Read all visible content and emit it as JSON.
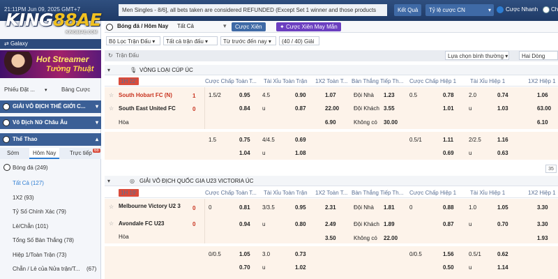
{
  "topbar": {
    "time": "21:11PM Jun 09, 2025 GMT+7",
    "notice": "Men Singles - 8/6], all bets taken are considered REFUNDED (Except Set 1 winner and those products",
    "result_button": "Kết Quả",
    "odds_select": "Tỷ lệ cược CN",
    "quick_bet_label": "Cược Nhanh",
    "quick_bet_on": true,
    "live_label": "Chế",
    "live_on": false
  },
  "logo": {
    "text_a": "KING",
    "text_b": "88AE",
    "sub": "KING88AE.COM"
  },
  "sidebar": {
    "galaxy_label": "Galaxy",
    "promo_line1": "Hot Streamer",
    "promo_line2": "Tường Thuật",
    "tab_betslip": "Phiếu Đặt ...",
    "tab_bets": "Bảng Cược",
    "sections": [
      {
        "label": "GIẢI VÔ ĐỊCH THẾ GIỚI C..."
      },
      {
        "label": "Vô Địch Nữ Châu Âu"
      },
      {
        "label": "Thể Thao"
      }
    ],
    "time_tabs": [
      "Sớm",
      "Hôm Nay",
      "Trực tiếp"
    ],
    "live_badge": "68",
    "items": [
      {
        "label": "Bóng đá",
        "count": "(249)"
      },
      {
        "label": "Tất Cả",
        "count": "(127)"
      },
      {
        "label": "1X2",
        "count": "(93)"
      },
      {
        "label": "Tỷ Số Chính Xác",
        "count": "(79)"
      },
      {
        "label": "Lẻ/Chẵn",
        "count": "(101)"
      },
      {
        "label": "Tổng Số Bàn Thắng",
        "count": "(78)"
      },
      {
        "label": "Hiệp 1/Toàn Trận",
        "count": "(73)"
      },
      {
        "label": "Chẵn / Lẻ của Nửa trận/T...",
        "count": "(67)"
      }
    ]
  },
  "breadcrumb": {
    "title": "Bóng đá / Hôm Nay",
    "filter": "Tất Cả",
    "btn_parlay": "Cược Xiên",
    "btn_lucky_parlay": "Cược Xiên May Mắn"
  },
  "filters": {
    "league_filter": "Bộ Lọc Trận Đấu",
    "all_matches": "Tất cả trận đấu",
    "sort": "Từ trước đến nay",
    "count": "(40 / 40) Giải",
    "normal_select": "Lựa chọn bình thường",
    "two_row": "Hai Dòng"
  },
  "section_label": "Trận Đấu",
  "page_badge": "35",
  "columns": [
    "Cược Chấp Toàn T...",
    "Tài Xỉu Toàn Trận",
    "1X2 Toàn T...",
    "Bàn Thắng Tiếp Th...",
    "Cược Chấp Hiệp 1",
    "Tài Xỉu Hiệp 1",
    "1X2 Hiệp 1"
  ],
  "leagues": [
    {
      "name": "VÒNG LOẠI CÚP ÚC",
      "time": "1H 22'",
      "home": "South Hobart FC (N)",
      "home_score": "1",
      "away": "South East United FC",
      "away_score": "0",
      "draw": "Hòa",
      "rows": [
        {
          "hdp_line": "1.5/2",
          "hdp_odds": "0.95",
          "ou_line": "4.5",
          "ou_odds": "0.90",
          "x12": "1.07",
          "next_label": "Đội Nhà",
          "next_odds": "1.23",
          "h1_line": "0.5",
          "h1_odds": "0.78",
          "h1ou_line": "2.0",
          "h1ou_odds": "0.74",
          "h1x12": "1.06"
        },
        {
          "hdp_line": "",
          "hdp_odds": "0.84",
          "ou_line": "u",
          "ou_odds": "0.87",
          "x12": "22.00",
          "next_label": "Đội Khách",
          "next_odds": "3.55",
          "h1_line": "",
          "h1_odds": "1.01",
          "h1ou_line": "u",
          "h1ou_odds": "1.03",
          "h1x12": "63.00"
        },
        {
          "hdp_line": "",
          "hdp_odds": "",
          "ou_line": "",
          "ou_odds": "",
          "x12": "6.90",
          "next_label": "Không có",
          "next_odds": "30.00",
          "h1_line": "",
          "h1_odds": "",
          "h1ou_line": "",
          "h1ou_odds": "",
          "h1x12": "6.10"
        }
      ],
      "extra": [
        {
          "hdp_line": "1.5",
          "hdp_odds": "0.75",
          "ou_line": "4/4.5",
          "ou_odds": "0.69",
          "h1_line": "0.5/1",
          "h1_odds": "1.11",
          "h1ou_line": "2/2.5",
          "h1ou_odds": "1.16"
        },
        {
          "hdp_line": "",
          "hdp_odds": "1.04",
          "ou_line": "u",
          "ou_odds": "1.08",
          "h1_line": "",
          "h1_odds": "0.69",
          "h1ou_line": "u",
          "h1ou_odds": "0.63"
        }
      ]
    },
    {
      "name": "GIẢI VÔ ĐỊCH QUỐC GIA U23 VICTORIA ÚC",
      "time": "1H 19'",
      "home": "Melbourne Victory U2 3",
      "home_score": "0",
      "away": "Avondale FC U23",
      "away_score": "0",
      "draw": "Hòa",
      "rows": [
        {
          "hdp_line": "0",
          "hdp_odds": "0.81",
          "ou_line": "3/3.5",
          "ou_odds": "0.95",
          "x12": "2.31",
          "next_label": "Đội Nhà",
          "next_odds": "1.81",
          "h1_line": "0",
          "h1_odds": "0.88",
          "h1ou_line": "1.0",
          "h1ou_odds": "1.05",
          "h1x12": "3.30"
        },
        {
          "hdp_line": "",
          "hdp_odds": "0.94",
          "ou_line": "u",
          "ou_odds": "0.80",
          "x12": "2.49",
          "next_label": "Đội Khách",
          "next_odds": "1.89",
          "h1_line": "",
          "h1_odds": "0.87",
          "h1ou_line": "u",
          "h1ou_odds": "0.70",
          "h1x12": "3.30"
        },
        {
          "hdp_line": "",
          "hdp_odds": "",
          "ou_line": "",
          "ou_odds": "",
          "x12": "3.50",
          "next_label": "Không có",
          "next_odds": "22.00",
          "h1_line": "",
          "h1_odds": "",
          "h1ou_line": "",
          "h1ou_odds": "",
          "h1x12": "1.93"
        }
      ],
      "extra": [
        {
          "hdp_line": "0/0.5",
          "hdp_odds": "1.05",
          "ou_line": "3.0",
          "ou_odds": "0.73",
          "h1_line": "0/0.5",
          "h1_odds": "1.56",
          "h1ou_line": "0.5/1",
          "h1ou_odds": "0.62"
        },
        {
          "hdp_line": "",
          "hdp_odds": "0.70",
          "ou_line": "u",
          "ou_odds": "1.02",
          "h1_line": "",
          "h1_odds": "0.50",
          "h1ou_line": "u",
          "h1ou_odds": "1.14"
        }
      ]
    }
  ]
}
